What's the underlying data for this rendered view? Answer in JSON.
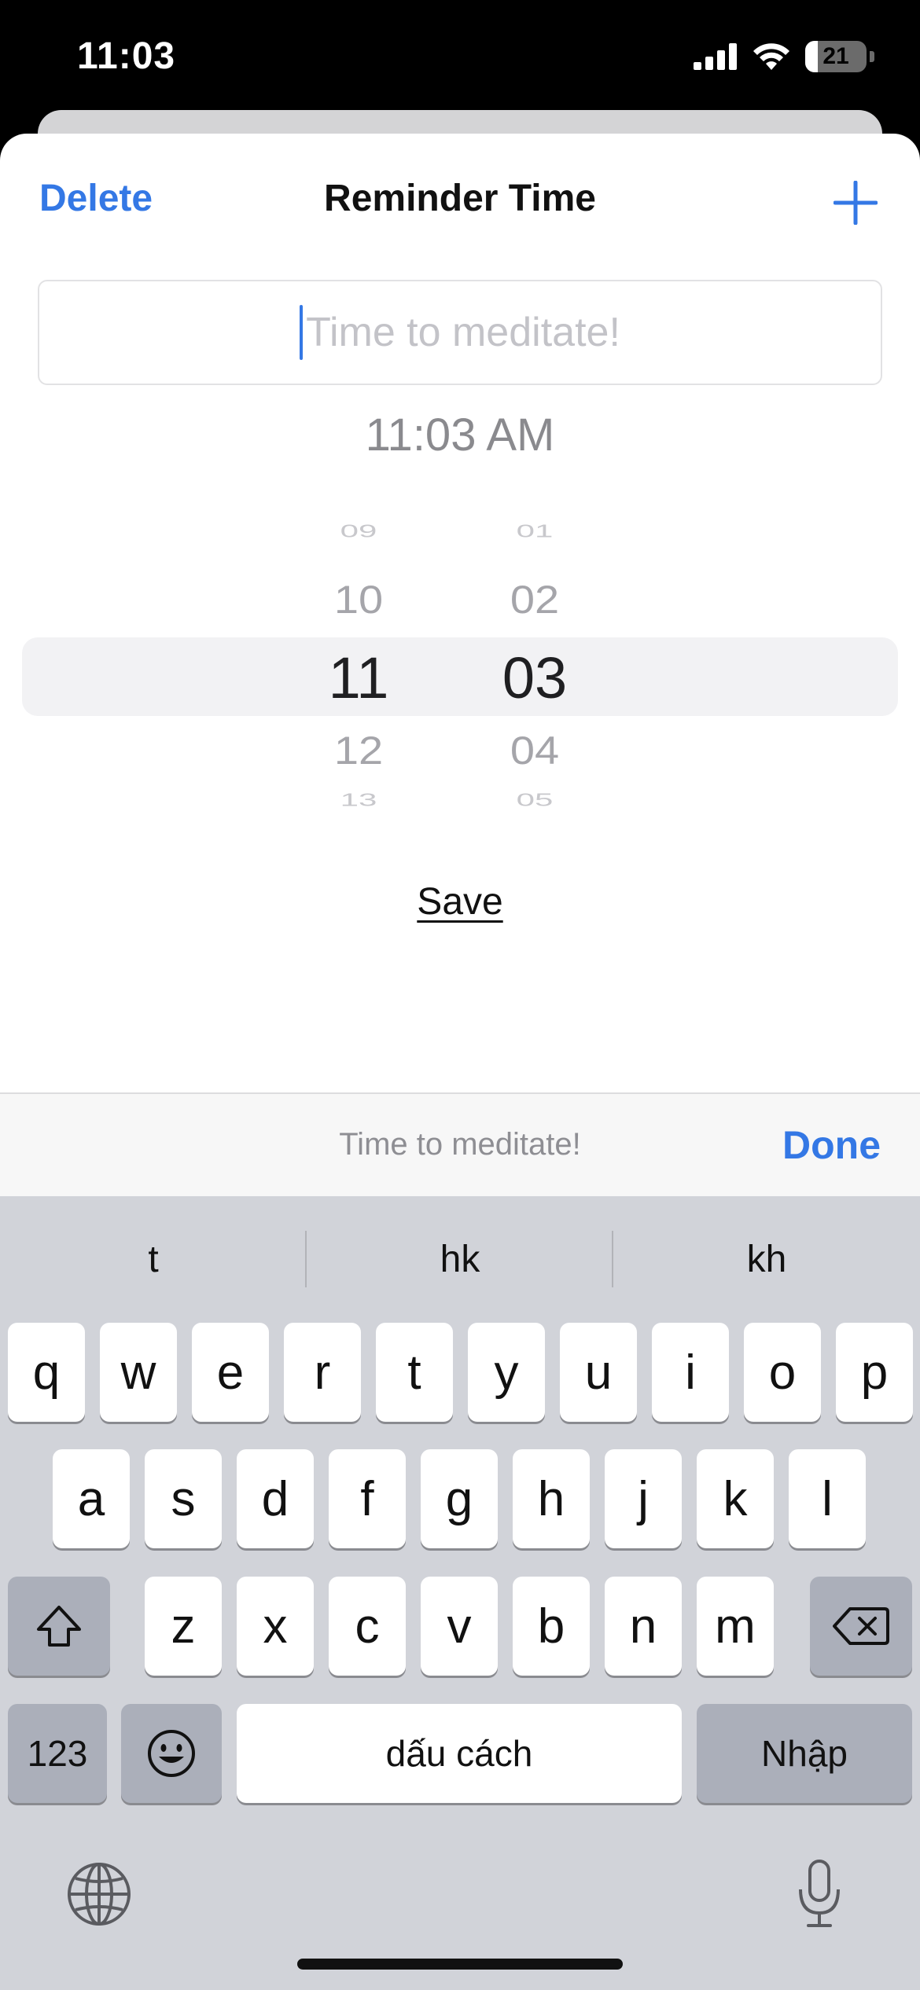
{
  "status_bar": {
    "time": "11:03",
    "battery": "21",
    "battery_level": 0.21
  },
  "sheet": {
    "delete_label": "Delete",
    "title": "Reminder Time",
    "reminder_placeholder": "Time to meditate!",
    "time_display": "11:03 AM",
    "picker": {
      "hours": [
        "09",
        "10",
        "11",
        "12",
        "13"
      ],
      "minutes": [
        "01",
        "02",
        "03",
        "04",
        "05"
      ],
      "selected_hour": "11",
      "selected_minute": "03"
    },
    "save_label": "Save"
  },
  "accessory_bar": {
    "preview_text": "Time to meditate!",
    "done_label": "Done"
  },
  "keyboard": {
    "suggestions": [
      "t",
      "hk",
      "kh"
    ],
    "row1": [
      "q",
      "w",
      "e",
      "r",
      "t",
      "y",
      "u",
      "i",
      "o",
      "p"
    ],
    "row2": [
      "a",
      "s",
      "d",
      "f",
      "g",
      "h",
      "j",
      "k",
      "l"
    ],
    "row3": [
      "z",
      "x",
      "c",
      "v",
      "b",
      "n",
      "m"
    ],
    "numbers_label": "123",
    "space_label": "dấu cách",
    "return_label": "Nhập"
  },
  "colors": {
    "accent": "#3478e5",
    "keyboard_bg": "#d1d3d9",
    "special_key": "#abafba"
  },
  "icons": {
    "add": "plus-icon",
    "shift": "shift-icon",
    "delete": "backspace-icon",
    "emoji": "emoji-icon",
    "globe": "globe-icon",
    "mic": "microphone-icon"
  }
}
